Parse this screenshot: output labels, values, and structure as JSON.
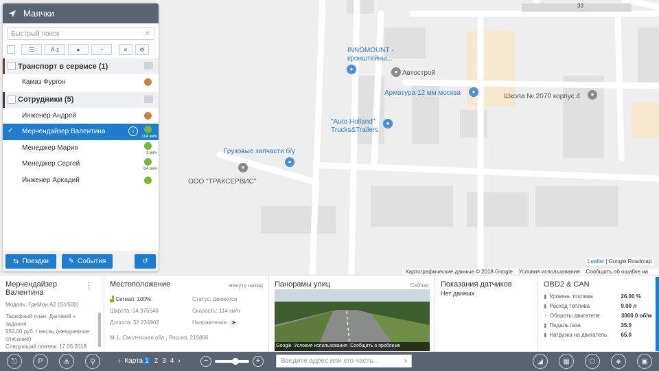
{
  "panel": {
    "title": "Маячки",
    "search_placeholder": "Быстрый поиск",
    "sort_az": "A-z",
    "groups": [
      {
        "name": "Транспорт в сервисе (1)",
        "items": [
          {
            "name": "Камаз Фургон",
            "status_color": "#c8843a",
            "speed": ""
          }
        ]
      },
      {
        "name": "Сотрудники (5)",
        "items": [
          {
            "name": "Инженер Андрей",
            "status_color": "#c8843a",
            "speed": ""
          },
          {
            "name": "Мерчендайзер Валентина",
            "status_color": "#7ab833",
            "speed": "114 км/ч",
            "selected": true
          },
          {
            "name": "Менеджер Мария",
            "status_color": "#7ab833",
            "speed": "1 км/ч"
          },
          {
            "name": "Менеджер Сергей",
            "status_color": "#7ab833",
            "speed": "64 км/ч"
          },
          {
            "name": "Инженер Аркадий",
            "status_color": "#7ab833",
            "speed": ""
          }
        ]
      }
    ],
    "btn_trips": "Поездки",
    "btn_events": "События"
  },
  "map": {
    "pois": {
      "innomount": "INNOMOUNT -\nкронштейны...",
      "avtostroy": "Автострой",
      "armatura": "Арматура 12 мм москва",
      "school": "Школа № 2070 корпус 4",
      "autoholland": "\"Auto Holland\"\nTrucks&Trailers",
      "gruz": "Грузовые запчасти б/у",
      "traks": "ООО \"ТРАКСЕРВИС\""
    },
    "attribution": "Картографические данные © 2018 Google",
    "terms": "Условия использования",
    "report": "Сообщить об ошибке на карте",
    "leaflet": "Leaflet",
    "provider": "Google Roadmap",
    "road_label": "33"
  },
  "details": {
    "name": "Мерчендайзер Валентина",
    "model": "Модель: ГдеМои A2 (GV500)",
    "tariff": "Тарифный план: Деловой + задания",
    "price": "550.00 руб. / месяц (ежедневное списание)",
    "next_payment": "Следующий платеж: 17.05.2018"
  },
  "location": {
    "title": "Местоположение",
    "time": "минуту назад",
    "signal": "Сигнал: 100%",
    "status": "Статус: Движется",
    "lat": "Широта: 54.975548",
    "speed": "Скорость: 114 км/ч",
    "lon": "Долгота: 32.234902",
    "direction": "Направление:",
    "address": "М-1, Смоленская обл., Россия, 215866"
  },
  "panorama": {
    "title": "Панорамы улиц",
    "time": "Сейчас",
    "google": "Google",
    "terms": "Условия использования",
    "report": "Сообщить о проблеме"
  },
  "sensors": {
    "title": "Показания датчиков",
    "empty": "Нет данных"
  },
  "obd": {
    "title": "OBD2 & CAN",
    "rows": [
      {
        "k": "Уровень топлива",
        "v": "26.00 %"
      },
      {
        "k": "Расход топлива",
        "v": "9.00 л"
      },
      {
        "k": "Обороты двигателя",
        "v": "3060.0 об/м"
      },
      {
        "k": "Педаль газа",
        "v": "35.0"
      },
      {
        "k": "Нагрузка на двигатель",
        "v": "65.0"
      }
    ]
  },
  "footer": {
    "map_label": "Карта",
    "pages": [
      "1",
      "2",
      "3",
      "4"
    ],
    "zoom_level": 0.6,
    "address_placeholder": "Введите адрес или его часть..."
  }
}
